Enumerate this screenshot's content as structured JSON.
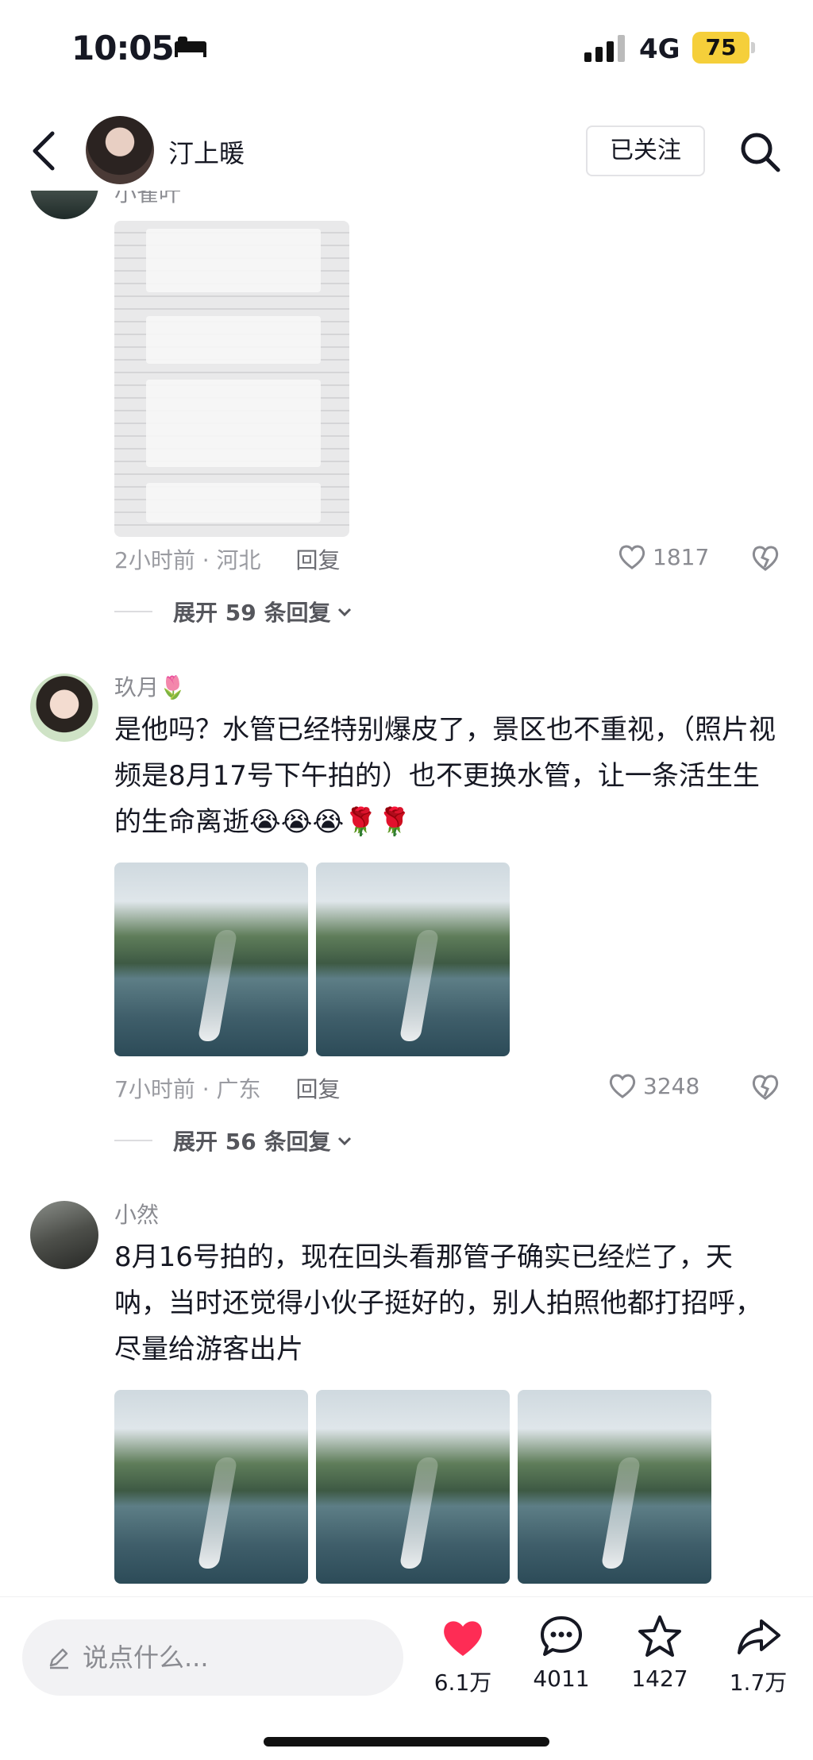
{
  "status_bar": {
    "time": "10:05",
    "network": "4G",
    "battery": "75"
  },
  "header": {
    "username": "汀上暖",
    "follow_label": "已关注"
  },
  "comments": [
    {
      "nickname": "小雀叶",
      "meta_time": "2小时前 · 河北",
      "reply_label": "回复",
      "likes": "1817",
      "expand_label": "展开 59 条回复"
    },
    {
      "nickname": "玖月🌷",
      "text": "是他吗？水管已经特别爆皮了，景区也不重视，（照片视频是8月17号下午拍的）也不更换水管，让一条活生生的生命离逝😭😭😭🌹🌹",
      "meta_time": "7小时前 · 广东",
      "reply_label": "回复",
      "likes": "3248",
      "expand_label": "展开 56 条回复"
    },
    {
      "nickname": "小然",
      "text": "8月16号拍的，现在回头看那管子确实已经烂了，天呐，当时还觉得小伙子挺好的，别人拍照他都打招呼，尽量给游客出片"
    }
  ],
  "bottom_bar": {
    "input_placeholder": "说点什么...",
    "like_count": "6.1万",
    "comment_count": "4011",
    "favorite_count": "1427",
    "share_count": "1.7万",
    "like_color": "#fe2c55"
  }
}
